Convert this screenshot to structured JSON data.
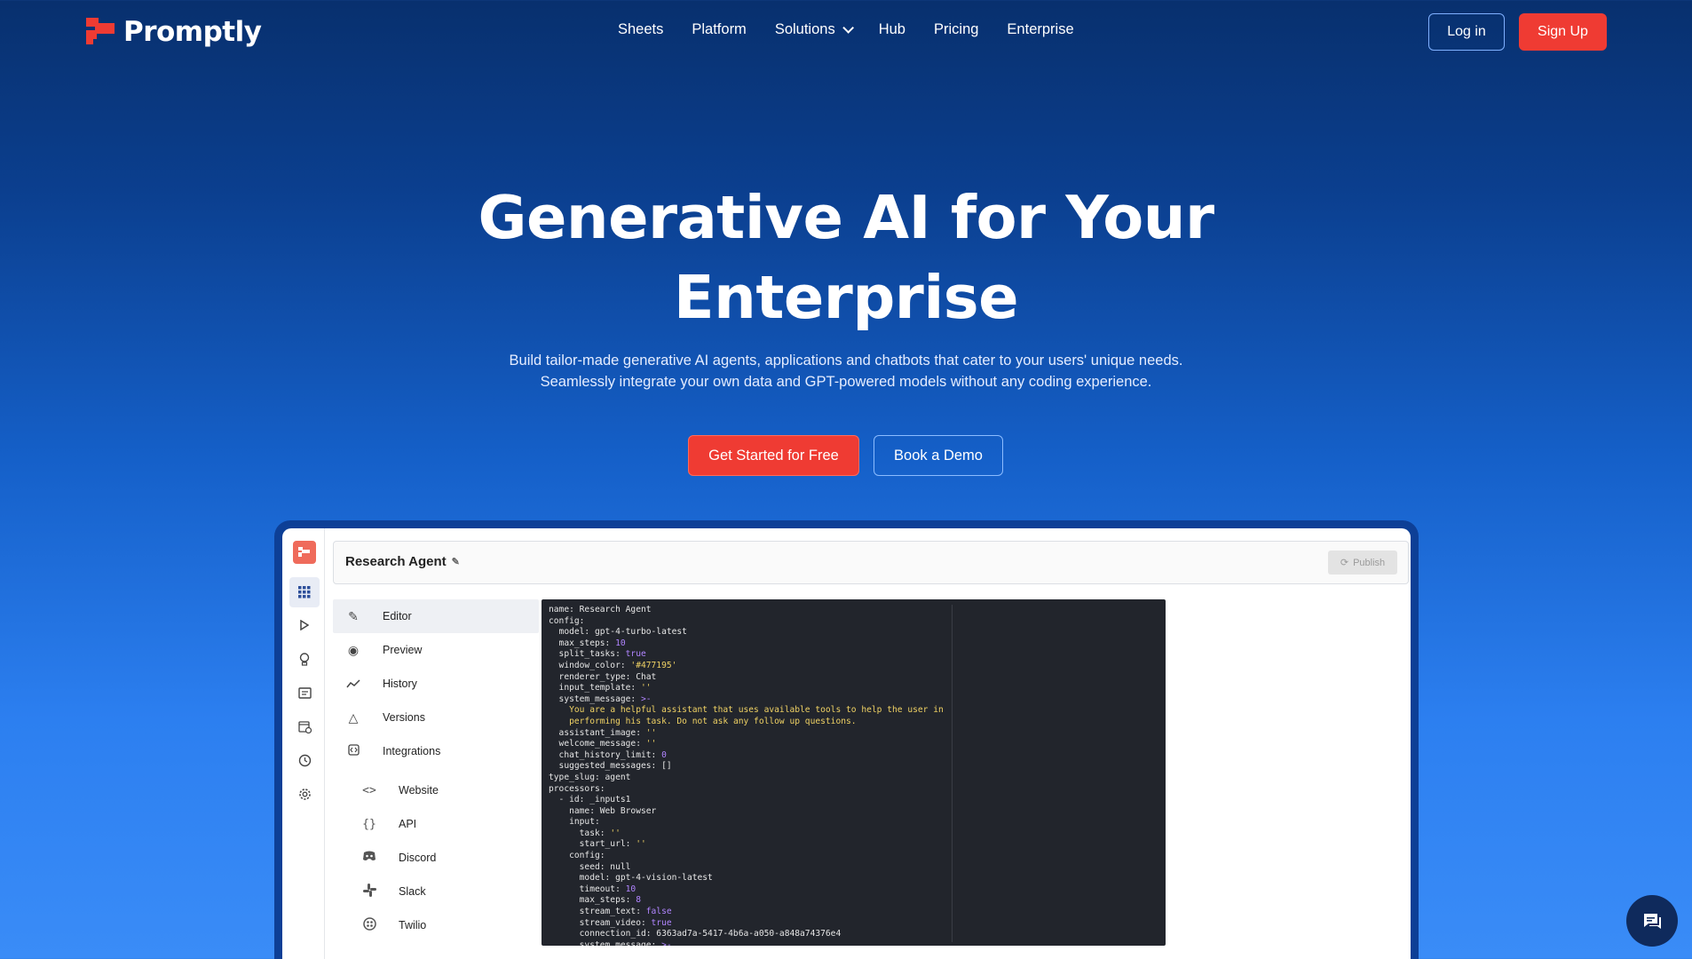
{
  "brand": {
    "name": "Promptly",
    "color": "#ef3b33"
  },
  "nav": {
    "links": [
      "Sheets",
      "Platform",
      "Solutions",
      "Hub",
      "Pricing",
      "Enterprise"
    ],
    "login": "Log in",
    "signup": "Sign Up"
  },
  "hero": {
    "title_line1": "Generative AI for Your",
    "title_line2": "Enterprise",
    "subtitle_line1": "Build tailor-made generative AI agents, applications and chatbots that cater to your users' unique needs.",
    "subtitle_line2": "Seamlessly integrate your own data and GPT-powered models without any coding experience.",
    "cta_primary": "Get Started for Free",
    "cta_secondary": "Book a Demo"
  },
  "app": {
    "agent_name": "Research Agent",
    "publish": "Publish",
    "sidebar": [
      {
        "label": "Editor",
        "icon": "pencil-icon"
      },
      {
        "label": "Preview",
        "icon": "eye-icon"
      },
      {
        "label": "History",
        "icon": "chart-icon"
      },
      {
        "label": "Versions",
        "icon": "triangle-icon"
      },
      {
        "label": "Integrations",
        "icon": "plug-icon"
      }
    ],
    "integrations": [
      {
        "label": "Website",
        "icon": "code-icon"
      },
      {
        "label": "API",
        "icon": "braces-icon"
      },
      {
        "label": "Discord",
        "icon": "discord-icon"
      },
      {
        "label": "Slack",
        "icon": "slack-icon"
      },
      {
        "label": "Twilio",
        "icon": "twilio-icon"
      }
    ]
  }
}
